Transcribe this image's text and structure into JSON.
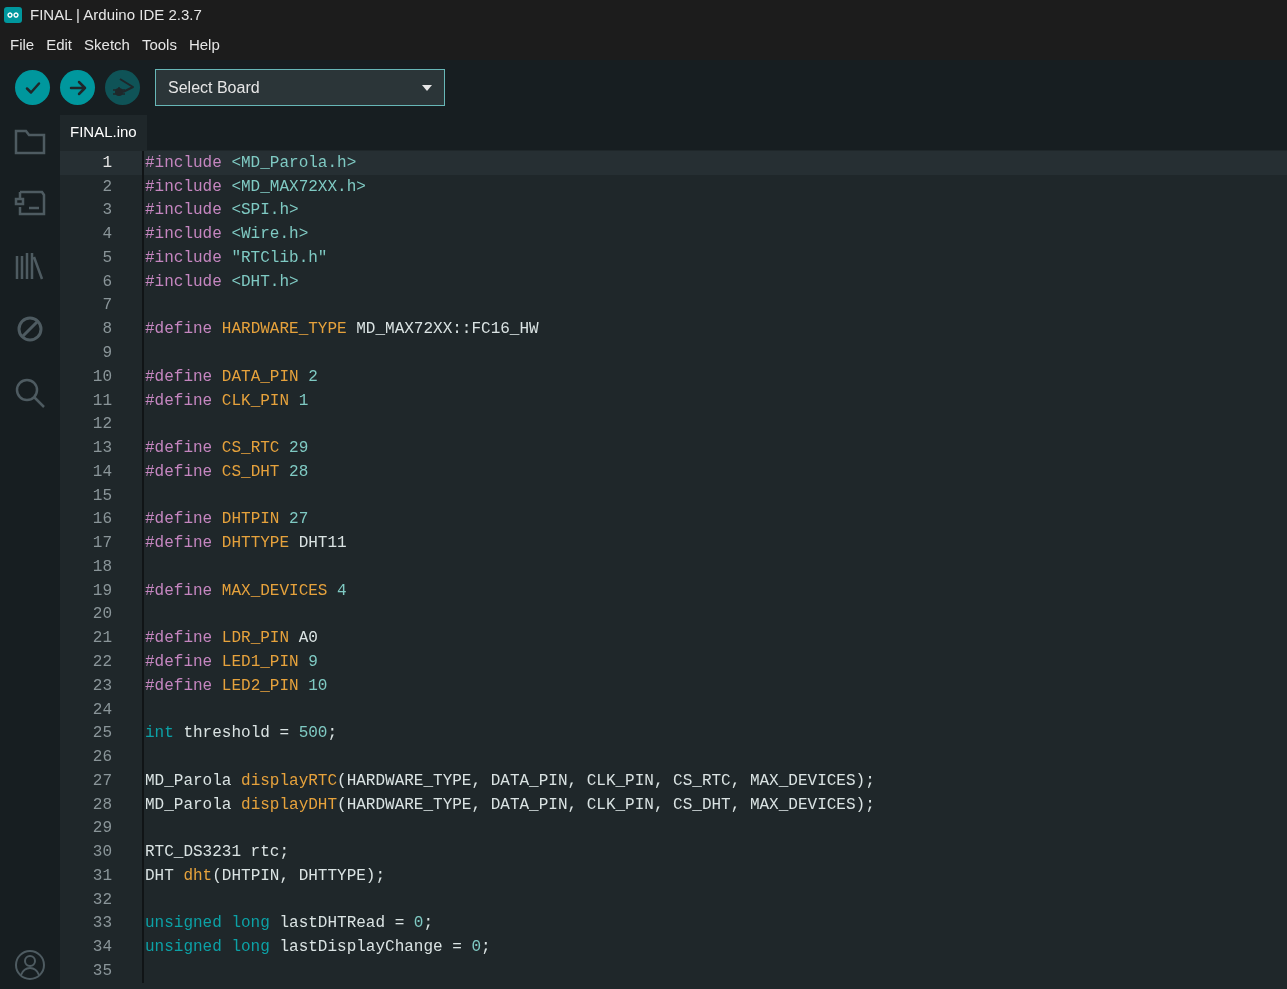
{
  "window": {
    "title": "FINAL | Arduino IDE 2.3.7"
  },
  "menu": [
    "File",
    "Edit",
    "Sketch",
    "Tools",
    "Help"
  ],
  "toolbar": {
    "buttons": [
      {
        "kind": "verify",
        "disabled": false
      },
      {
        "kind": "upload",
        "disabled": false
      },
      {
        "kind": "debug",
        "disabled": true
      }
    ],
    "board_select": {
      "value": "Select Board"
    }
  },
  "sidebar": {
    "items": [
      {
        "kind": "folder"
      },
      {
        "kind": "board"
      },
      {
        "kind": "library"
      },
      {
        "kind": "debug"
      },
      {
        "kind": "search"
      }
    ],
    "bottom": [
      {
        "kind": "account"
      }
    ]
  },
  "tabs": [
    {
      "label": "FINAL.ino",
      "selected": true
    }
  ],
  "editor": {
    "lines": [
      {
        "number": "1",
        "selected": true,
        "tokens": [
          {
            "kind": "directive",
            "t": "#include"
          },
          {
            "kind": "path",
            "t": " <MD_Parola.h>"
          }
        ]
      },
      {
        "number": "2",
        "selected": false,
        "tokens": [
          {
            "kind": "directive",
            "t": "#include"
          },
          {
            "kind": "path",
            "t": " <MD_MAX72XX.h>"
          }
        ]
      },
      {
        "number": "3",
        "selected": false,
        "tokens": [
          {
            "kind": "directive",
            "t": "#include"
          },
          {
            "kind": "path",
            "t": " <SPI.h>"
          }
        ]
      },
      {
        "number": "4",
        "selected": false,
        "tokens": [
          {
            "kind": "directive",
            "t": "#include"
          },
          {
            "kind": "path",
            "t": " <Wire.h>"
          }
        ]
      },
      {
        "number": "5",
        "selected": false,
        "tokens": [
          {
            "kind": "directive",
            "t": "#include"
          },
          {
            "kind": "path",
            "t": " \"RTClib.h\""
          }
        ]
      },
      {
        "number": "6",
        "selected": false,
        "tokens": [
          {
            "kind": "directive",
            "t": "#include"
          },
          {
            "kind": "path",
            "t": " <DHT.h>"
          }
        ]
      },
      {
        "number": "7",
        "selected": false
      },
      {
        "number": "8",
        "selected": false,
        "tokens": [
          {
            "kind": "directive",
            "t": "#define"
          },
          {
            "kind": "macro",
            "t": " HARDWARE_TYPE"
          },
          {
            "kind": "plain",
            "t": " MD_MAX72XX::FC16_HW"
          }
        ]
      },
      {
        "number": "9",
        "selected": false
      },
      {
        "number": "10",
        "selected": false,
        "tokens": [
          {
            "kind": "directive",
            "t": "#define"
          },
          {
            "kind": "macro",
            "t": " DATA_PIN"
          },
          {
            "kind": "number",
            "t": " 2"
          }
        ]
      },
      {
        "number": "11",
        "selected": false,
        "tokens": [
          {
            "kind": "directive",
            "t": "#define"
          },
          {
            "kind": "macro",
            "t": " CLK_PIN"
          },
          {
            "kind": "number",
            "t": " 1"
          }
        ]
      },
      {
        "number": "12",
        "selected": false
      },
      {
        "number": "13",
        "selected": false,
        "tokens": [
          {
            "kind": "directive",
            "t": "#define"
          },
          {
            "kind": "macro",
            "t": " CS_RTC"
          },
          {
            "kind": "number",
            "t": " 29"
          }
        ]
      },
      {
        "number": "14",
        "selected": false,
        "tokens": [
          {
            "kind": "directive",
            "t": "#define"
          },
          {
            "kind": "macro",
            "t": " CS_DHT"
          },
          {
            "kind": "number",
            "t": " 28"
          }
        ]
      },
      {
        "number": "15",
        "selected": false
      },
      {
        "number": "16",
        "selected": false,
        "tokens": [
          {
            "kind": "directive",
            "t": "#define"
          },
          {
            "kind": "macro",
            "t": " DHTPIN"
          },
          {
            "kind": "number",
            "t": " 27"
          }
        ]
      },
      {
        "number": "17",
        "selected": false,
        "tokens": [
          {
            "kind": "directive",
            "t": "#define"
          },
          {
            "kind": "macro",
            "t": " DHTTYPE"
          },
          {
            "kind": "plain",
            "t": " DHT11"
          }
        ]
      },
      {
        "number": "18",
        "selected": false
      },
      {
        "number": "19",
        "selected": false,
        "tokens": [
          {
            "kind": "directive",
            "t": "#define"
          },
          {
            "kind": "macro",
            "t": " MAX_DEVICES"
          },
          {
            "kind": "number",
            "t": " 4"
          }
        ]
      },
      {
        "number": "20",
        "selected": false
      },
      {
        "number": "21",
        "selected": false,
        "tokens": [
          {
            "kind": "directive",
            "t": "#define"
          },
          {
            "kind": "macro",
            "t": " LDR_PIN"
          },
          {
            "kind": "plain",
            "t": " A0"
          }
        ]
      },
      {
        "number": "22",
        "selected": false,
        "tokens": [
          {
            "kind": "directive",
            "t": "#define"
          },
          {
            "kind": "macro",
            "t": " LED1_PIN"
          },
          {
            "kind": "number",
            "t": " 9"
          }
        ]
      },
      {
        "number": "23",
        "selected": false,
        "tokens": [
          {
            "kind": "directive",
            "t": "#define"
          },
          {
            "kind": "macro",
            "t": " LED2_PIN"
          },
          {
            "kind": "number",
            "t": " 10"
          }
        ]
      },
      {
        "number": "24",
        "selected": false
      },
      {
        "number": "25",
        "selected": false,
        "tokens": [
          {
            "kind": "type",
            "t": "int"
          },
          {
            "kind": "plain",
            "t": " threshold ="
          },
          {
            "kind": "number",
            "t": " 500"
          },
          {
            "kind": "plain",
            "t": ";"
          }
        ]
      },
      {
        "number": "26",
        "selected": false
      },
      {
        "number": "27",
        "selected": false,
        "tokens": [
          {
            "kind": "plain",
            "t": "MD_Parola"
          },
          {
            "kind": "function",
            "t": " displayRTC"
          },
          {
            "kind": "plain",
            "t": "(HARDWARE_TYPE, DATA_PIN, CLK_PIN, CS_RTC, MAX_DEVICES);"
          }
        ]
      },
      {
        "number": "28",
        "selected": false,
        "tokens": [
          {
            "kind": "plain",
            "t": "MD_Parola"
          },
          {
            "kind": "function",
            "t": " displayDHT"
          },
          {
            "kind": "plain",
            "t": "(HARDWARE_TYPE, DATA_PIN, CLK_PIN, CS_DHT, MAX_DEVICES);"
          }
        ]
      },
      {
        "number": "29",
        "selected": false
      },
      {
        "number": "30",
        "selected": false,
        "tokens": [
          {
            "kind": "plain",
            "t": "RTC_DS3231 rtc;"
          }
        ]
      },
      {
        "number": "31",
        "selected": false,
        "tokens": [
          {
            "kind": "plain",
            "t": "DHT"
          },
          {
            "kind": "function",
            "t": " dht"
          },
          {
            "kind": "plain",
            "t": "(DHTPIN, DHTTYPE);"
          }
        ]
      },
      {
        "number": "32",
        "selected": false
      },
      {
        "number": "33",
        "selected": false,
        "tokens": [
          {
            "kind": "type",
            "t": "unsigned"
          },
          {
            "kind": "type",
            "t": " long"
          },
          {
            "kind": "plain",
            "t": " lastDHTRead ="
          },
          {
            "kind": "number",
            "t": " 0"
          },
          {
            "kind": "plain",
            "t": ";"
          }
        ]
      },
      {
        "number": "34",
        "selected": false,
        "tokens": [
          {
            "kind": "type",
            "t": "unsigned"
          },
          {
            "kind": "type",
            "t": " long"
          },
          {
            "kind": "plain",
            "t": " lastDisplayChange ="
          },
          {
            "kind": "number",
            "t": " 0"
          },
          {
            "kind": "plain",
            "t": ";"
          }
        ]
      },
      {
        "number": "35",
        "selected": false
      }
    ]
  }
}
